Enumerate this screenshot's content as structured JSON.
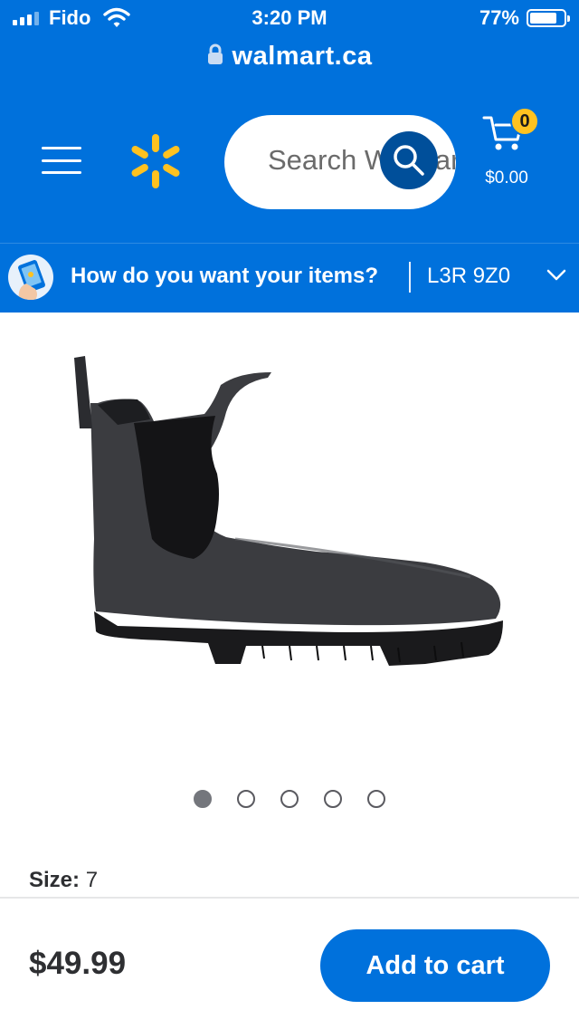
{
  "status_bar": {
    "carrier": "Fido",
    "time": "3:20 PM",
    "battery": "77%",
    "battery_level": 0.77,
    "icons": [
      "signal-icon",
      "wifi-icon",
      "battery-icon"
    ]
  },
  "browser": {
    "url": "walmart.ca",
    "icon": "lock-icon"
  },
  "header": {
    "menu_icon": "menu-icon",
    "logo_icon": "walmart-spark-icon",
    "search_placeholder": "Search Walmart",
    "search_icon": "search-icon",
    "cart_icon": "cart-icon",
    "cart_count": "0",
    "cart_total": "$0.00"
  },
  "delivery": {
    "icon": "phone-pickup-icon",
    "question": "How do you want your items?",
    "separator": "|",
    "postal_code": "L3R 9Z0",
    "chevron_icon": "chevron-down-icon"
  },
  "product": {
    "image_icon": "chelsea-boot-image",
    "carousel": {
      "count": 5,
      "active_index": 0
    },
    "size_label": "Size:",
    "size_value": "7",
    "price": "$49.99",
    "add_to_cart_label": "Add to cart"
  },
  "colors": {
    "brand_blue": "#0071dc",
    "dark_blue": "#004f9a",
    "spark_yellow": "#ffc220",
    "text_dark": "#2e2f32"
  }
}
